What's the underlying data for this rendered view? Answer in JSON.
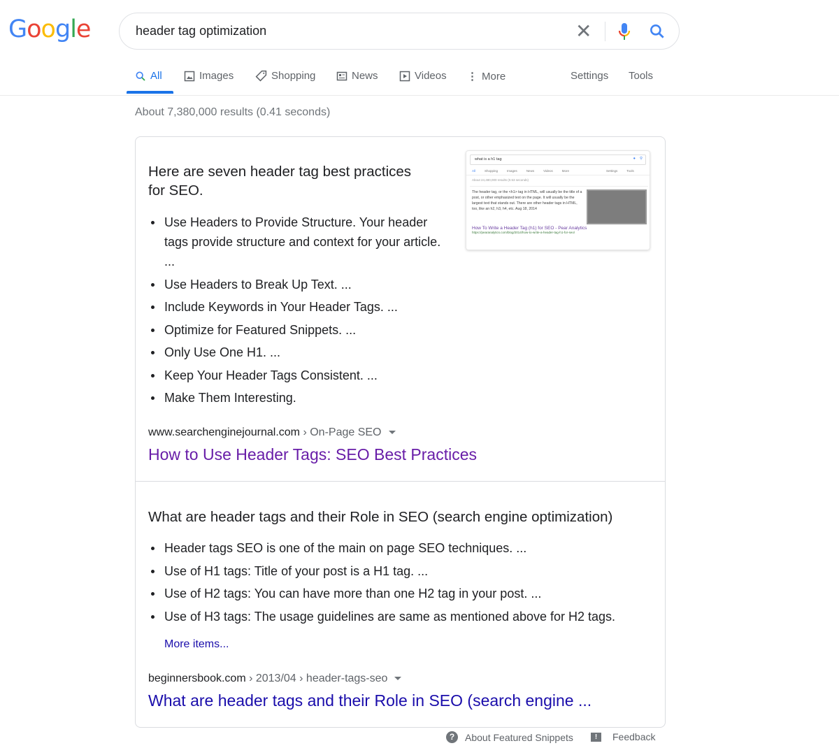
{
  "logo": {
    "letters": [
      "G",
      "o",
      "o",
      "g",
      "l",
      "e"
    ],
    "colors": [
      "#4285f4",
      "#ea4335",
      "#fbbc05",
      "#4285f4",
      "#34a853",
      "#ea4335"
    ]
  },
  "search": {
    "query": "header tag optimization"
  },
  "tabs": [
    {
      "label": "All",
      "icon": "search-icon",
      "active": true
    },
    {
      "label": "Images",
      "icon": "image-icon"
    },
    {
      "label": "Shopping",
      "icon": "tag-icon"
    },
    {
      "label": "News",
      "icon": "news-icon"
    },
    {
      "label": "Videos",
      "icon": "play-icon"
    },
    {
      "label": "More",
      "icon": "more-vert-icon"
    }
  ],
  "tools": {
    "settings": "Settings",
    "tools": "Tools"
  },
  "stats": "About 7,380,000 results (0.41 seconds)",
  "snippet1": {
    "heading": "Here are seven header tag best practices for SEO.",
    "items": [
      "Use Headers to Provide Structure. Your header tags provide structure and context for your article. ...",
      "Use Headers to Break Up Text. ...",
      "Include Keywords in Your Header Tags. ...",
      "Optimize for Featured Snippets. ...",
      "Only Use One H1. ...",
      "Keep Your Header Tags Consistent. ...",
      "Make Them Interesting."
    ],
    "cite_domain": "www.searchenginejournal.com",
    "cite_path": " › On-Page SEO",
    "title": "How to Use Header Tags: SEO Best Practices",
    "thumb": {
      "query": "what is a h1 tag",
      "tabs": [
        "All",
        "Shopping",
        "Images",
        "News",
        "Videos",
        "More",
        "Settings",
        "Tools"
      ],
      "stats": "About 24,480,000 results (0.53 seconds)",
      "text": "The header tag, or the <h1> tag in HTML, will usually be the title of a post, or other emphasized text on the page. It will usually be the largest text that stands out. There are other header tags in HTML, too, like an h2, h3, h4, etc. Aug 18, 2014",
      "title": "How To Write a Header Tag (h1) for SEO - Pear Analytics",
      "url": "https://pearanalytics.com/blog/2014/how-to-write-a-header-tag-h1-for-seo/"
    }
  },
  "snippet2": {
    "heading": "What are header tags and their Role in SEO (search engine optimization)",
    "items": [
      "Header tags SEO is one of the main on page SEO techniques. ...",
      "Use of H1 tags: Title of your post is a H1 tag. ...",
      "Use of H2 tags: You can have more than one H2 tag in your post. ...",
      "Use of H3 tags: The usage guidelines are same as mentioned above for H2 tags."
    ],
    "more": "More items...",
    "cite_domain": "beginnersbook.com",
    "cite_path": " › 2013/04 › header-tags-seo",
    "title": "What are header tags and their Role in SEO (search engine ..."
  },
  "footer": {
    "about": "About Featured Snippets",
    "feedback": "Feedback"
  }
}
